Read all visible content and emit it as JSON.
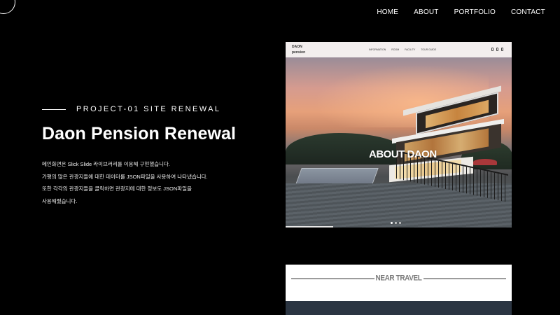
{
  "nav": {
    "items": [
      "HOME",
      "ABOUT",
      "PORTFOLIO",
      "CONTACT"
    ]
  },
  "project": {
    "kicker": "PROJECT-01 SITE RENEWAL",
    "title": "Daon Pension Renewal",
    "description": [
      "메인화면은 Slick Slide 라이브러리를 이용해 구현했습니다.",
      "가평의 많은 관광지들에 대한 데이터를 JSON파일을 사용하여 나타냈습니다.",
      "또한 각각의 관광지들을 클릭하면 관광지에 대한 정보도 JSON파일을",
      "사용해줬습니다."
    ]
  },
  "screenshot": {
    "logo_line1": "DAON",
    "logo_line2": "pension",
    "menu": [
      "INFORMATION",
      "ROOM",
      "FACILITY",
      "TOUR GUIDE"
    ],
    "icons": [
      "user-icon",
      "trash-icon",
      "bookmark-icon"
    ],
    "about_small": "",
    "about_title": "ABOUT DAON",
    "slide_count": 3,
    "active_slide": 1,
    "progress": 0.21
  },
  "near": {
    "title": "NEAR TRAVEL"
  },
  "colors": {
    "background": "#000000",
    "text": "#ffffff",
    "near_strip": "#2b3542"
  }
}
